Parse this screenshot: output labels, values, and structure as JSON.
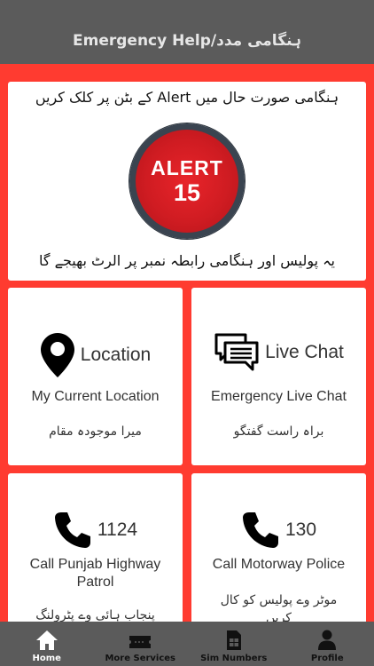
{
  "header": {
    "title": "Emergency Help/ہنگامی مدد"
  },
  "alert_card": {
    "instruction": "ہنگامی صورت حال میں Alert کے بٹن پر کلک کریں",
    "button_word": "ALERT",
    "button_number": "15",
    "note": "یہ پولیس اور ہنگامی رابطہ نمبر پر الرٹ بھیجے گا"
  },
  "cards": {
    "location": {
      "title": "Location",
      "subtitle": "My Current Location",
      "urdu": "میرا موجودہ مقام",
      "icon": "location-pin-icon"
    },
    "chat": {
      "title": "Live Chat",
      "subtitle": "Emergency Live Chat",
      "urdu": "براہ راست گفتگو",
      "icon": "chat-bubbles-icon"
    },
    "patrol": {
      "title": "1124",
      "subtitle": "Call Punjab Highway Patrol",
      "urdu": "پنجاب ہائی وے پٹرولنگ کو",
      "icon": "phone-icon"
    },
    "motorway": {
      "title": "130",
      "subtitle": "Call Motorway Police",
      "urdu": "موٹر وے پولیس کو کال کریں",
      "icon": "phone-icon"
    }
  },
  "tabs": [
    {
      "label": "Home",
      "icon": "home-icon",
      "active": true
    },
    {
      "label": "More Services",
      "icon": "ticket-icon",
      "active": false
    },
    {
      "label": "Sim Numbers",
      "icon": "sim-card-icon",
      "active": false
    },
    {
      "label": "Profile",
      "icon": "person-icon",
      "active": false
    }
  ],
  "colors": {
    "accent": "#ff3b30",
    "header": "#5b5b5b",
    "alert_red": "#d01c22",
    "alert_ring": "#3a4450"
  }
}
